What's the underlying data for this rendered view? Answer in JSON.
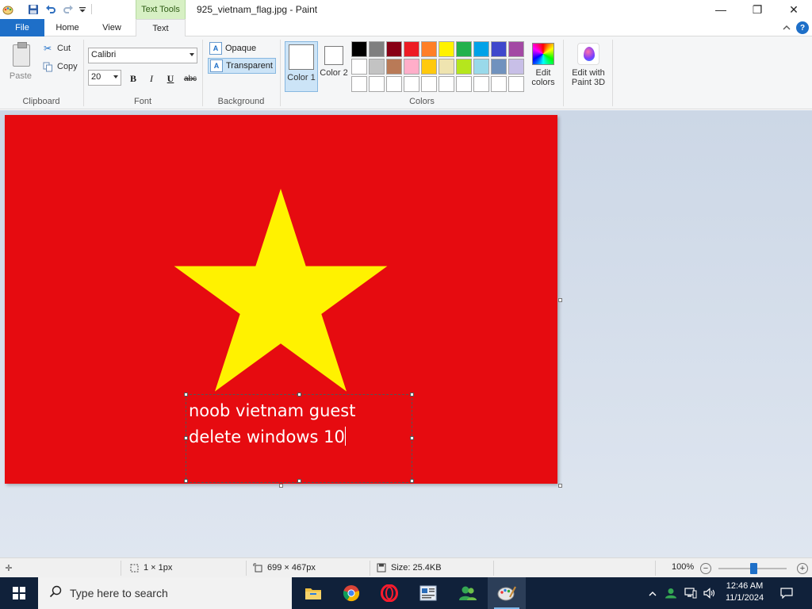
{
  "window": {
    "title": "925_vietnam_flag.jpg - Paint",
    "context_tab": "Text Tools",
    "minimize": "—",
    "maximize": "❐",
    "close": "✕"
  },
  "tabs": {
    "file": "File",
    "home": "Home",
    "view": "View",
    "text": "Text",
    "help": "?"
  },
  "clipboard": {
    "label": "Clipboard",
    "paste": "Paste",
    "cut": "Cut",
    "copy": "Copy"
  },
  "font": {
    "label": "Font",
    "family": "Calibri",
    "size": "20",
    "bold": "B",
    "italic": "I",
    "underline": "U",
    "strike": "abc"
  },
  "background": {
    "label": "Background",
    "opaque": "Opaque",
    "transparent": "Transparent",
    "selected": "transparent"
  },
  "colors": {
    "label": "Colors",
    "color1": "Color 1",
    "color2": "Color 2",
    "color1_value": "#ffffff",
    "color2_value": "#ffffff",
    "edit_colors": "Edit colors",
    "edit_paint3d": "Edit with Paint 3D",
    "palette_row1": [
      "#000000",
      "#7f7f7f",
      "#880015",
      "#ed1c24",
      "#ff7f27",
      "#fff200",
      "#22b14c",
      "#00a2e8",
      "#3f48cc",
      "#a349a4"
    ],
    "palette_row2": [
      "#ffffff",
      "#c3c3c3",
      "#b97a57",
      "#ffaec9",
      "#ffc90e",
      "#efe4b0",
      "#b5e61d",
      "#99d9ea",
      "#7092be",
      "#c8bfe7"
    ],
    "palette_row3": [
      "#ffffff",
      "#ffffff",
      "#ffffff",
      "#ffffff",
      "#ffffff",
      "#ffffff",
      "#ffffff",
      "#ffffff",
      "#ffffff",
      "#ffffff"
    ]
  },
  "canvas": {
    "flag_red": "#e60b10",
    "star_yellow": "#fff200",
    "text_line1": "noob vietnam guest",
    "text_line2": "delete windows 10"
  },
  "status": {
    "cursor": "1 × 1px",
    "dimensions": "699 × 467px",
    "size": "Size: 25.4KB",
    "zoom": "100%"
  },
  "taskbar": {
    "search_placeholder": "Type here to search",
    "time": "12:46 AM",
    "date": "11/1/2024"
  }
}
